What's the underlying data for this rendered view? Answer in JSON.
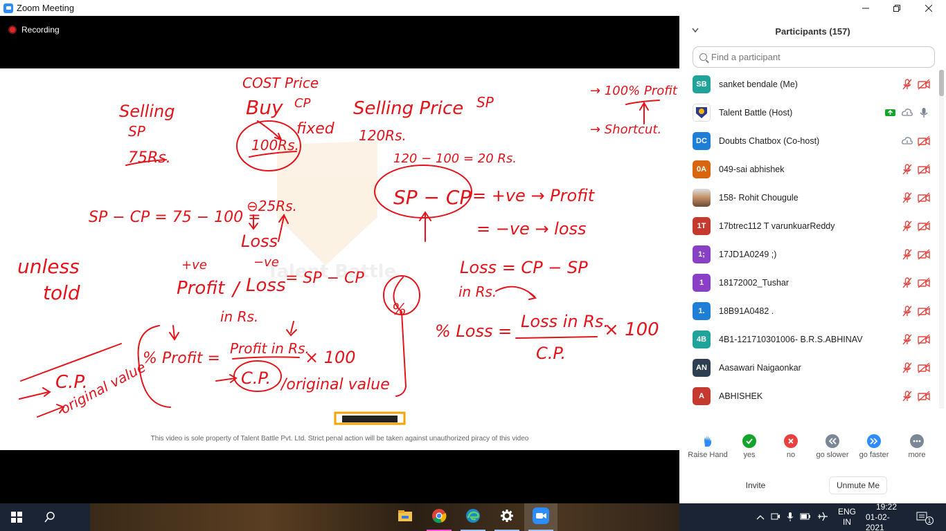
{
  "window": {
    "title": "Zoom Meeting"
  },
  "meeting": {
    "recording_label": "Recording",
    "watermark": "This video is sole property of Talent Battle Pvt. Ltd. Strict penal action will be taken against unauthorized piracy of this video",
    "whiteboard_logo_text": "Talent Battle",
    "whiteboard_text": [
      "COST Price",
      "Buy",
      "CP",
      "100Rs.",
      "fixed",
      "Selling",
      "SP",
      "75Rs.",
      "Selling Price",
      "SP",
      "120Rs.",
      "→ 100% Profit",
      "→ Shortcut.",
      "120 − 100 = 20 Rs.",
      "SP − CP",
      "= +ve → Profit",
      "= −ve → loss",
      "SP − CP = 75 − 100 =",
      "⊖25Rs.",
      "Loss",
      "unless",
      "told",
      "+ve",
      "−ve",
      "Profit",
      "/",
      "Loss",
      "= SP − CP",
      "in Rs.",
      "Loss = CP − SP",
      "in Rs.",
      "%",
      "% Loss =",
      "Loss in Rs.",
      "C.P.",
      "× 100",
      "C.P.",
      "original value",
      "% Profit =",
      "Profit in Rs.",
      "× 100",
      "C.P.",
      "/original value"
    ]
  },
  "participants_panel": {
    "title": "Participants (157)",
    "search_placeholder": "Find a participant",
    "participants": [
      {
        "initials": "SB",
        "name": "sanket bendale (Me)",
        "color": "#20a39a",
        "mic": "muted",
        "video": "off"
      },
      {
        "initials": "TB",
        "name": "Talent Battle (Host)",
        "color": "#ffffff",
        "mic": "on",
        "video": "cloud",
        "share": true,
        "logo": true
      },
      {
        "initials": "DC",
        "name": "Doubts Chatbox (Co-host)",
        "color": "#1f7ed6",
        "mic": "cloud",
        "video": "off"
      },
      {
        "initials": "0A",
        "name": "049-sai abhishek",
        "color": "#d9660f",
        "mic": "muted",
        "video": "off"
      },
      {
        "initials": "",
        "name": "158- Rohit Chougule",
        "color": "#c9a37a",
        "mic": "muted",
        "video": "off",
        "photo": true
      },
      {
        "initials": "1T",
        "name": "17btrec112 T varunkuarReddy",
        "color": "#c43a2f",
        "mic": "muted",
        "video": "off"
      },
      {
        "initials": "1;",
        "name": "17JD1A0249 ;)",
        "color": "#8a3fc7",
        "mic": "muted",
        "video": "off"
      },
      {
        "initials": "1",
        "name": "18172002_Tushar",
        "color": "#8a3fc7",
        "mic": "muted",
        "video": "off"
      },
      {
        "initials": "1.",
        "name": "18B91A0482 .",
        "color": "#1f7ed6",
        "mic": "muted",
        "video": "off"
      },
      {
        "initials": "4B",
        "name": "4B1-121710301006- B.R.S.ABHINAV",
        "color": "#20a39a",
        "mic": "muted",
        "video": "off"
      },
      {
        "initials": "AN",
        "name": "Aasawari Naigaonkar",
        "color": "#2e3f52",
        "mic": "muted",
        "video": "off"
      },
      {
        "initials": "A",
        "name": "ABHISHEK",
        "color": "#c43a2f",
        "mic": "muted",
        "video": "off"
      }
    ],
    "reactions": [
      {
        "label": "Raise Hand",
        "icon": "raise-hand-icon",
        "color": "#2d8cff"
      },
      {
        "label": "yes",
        "icon": "check-icon",
        "color": "#13a52a"
      },
      {
        "label": "no",
        "icon": "cross-icon",
        "color": "#e8403f"
      },
      {
        "label": "go slower",
        "icon": "rewind-icon",
        "color": "#7b8796"
      },
      {
        "label": "go faster",
        "icon": "fast-forward-icon",
        "color": "#2d8cff"
      },
      {
        "label": "more",
        "icon": "more-icon",
        "color": "#7b8796"
      }
    ],
    "invite_label": "Invite",
    "unmute_label": "Unmute Me"
  },
  "taskbar": {
    "apps": [
      "file-explorer-icon",
      "chrome-icon",
      "edge-icon",
      "settings-icon",
      "zoom-icon"
    ],
    "lang_top": "ENG",
    "lang_bottom": "IN",
    "time": "19:22",
    "date": "01-02-2021",
    "notification_count": "1"
  },
  "colors": {
    "zoom_blue": "#2d8cff",
    "ink_red": "#e5141b",
    "panel_bg": "#ffffff",
    "taskbar_bg": "#1b2434"
  }
}
